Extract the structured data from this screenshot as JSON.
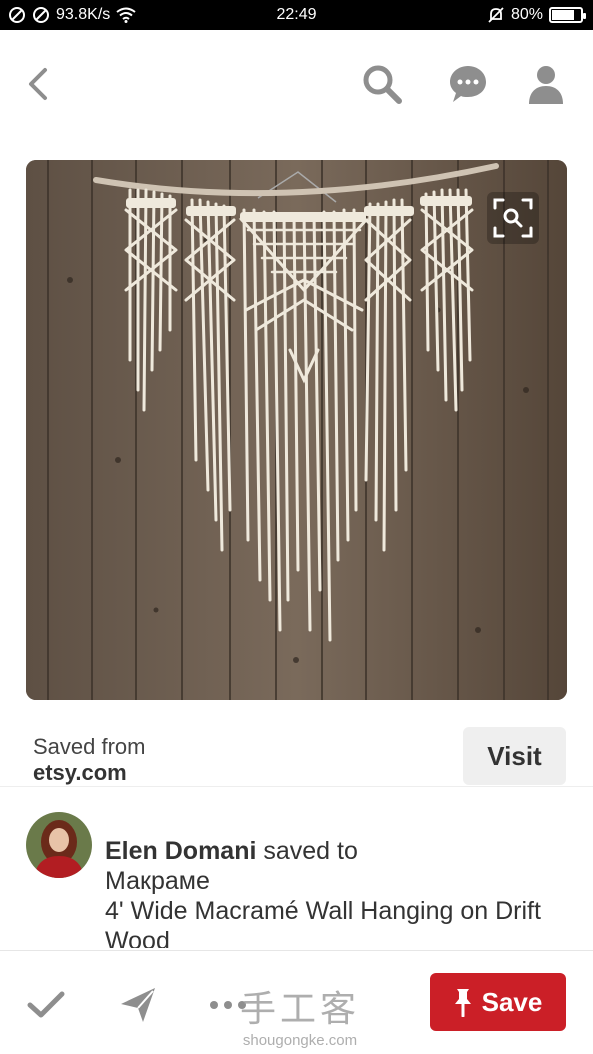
{
  "status_bar": {
    "speed": "93.8K/s",
    "time": "22:49",
    "battery": "80%",
    "battery_level": 0.8
  },
  "nav": {
    "back_icon": "chevron-left-icon",
    "search_icon": "search-icon",
    "messages_icon": "chat-bubble-icon",
    "profile_icon": "person-icon"
  },
  "pin": {
    "image_description_icon": "macrame-wall-hanging-photo",
    "visual_search_icon": "lens-search-icon"
  },
  "source": {
    "saved_from_label": "Saved from",
    "domain": "etsy.com",
    "visit_label": "Visit"
  },
  "saver": {
    "name": "Elen Domani",
    "action": " saved to",
    "board": "Макраме",
    "description": "4' Wide Macramé Wall Hanging on Drift Wood"
  },
  "bottom": {
    "save_label": "Save",
    "check_icon": "check-icon",
    "send_icon": "send-icon",
    "more_icon": "more-icon"
  },
  "watermark": {
    "cn": "手工客",
    "url": "shougongke.com"
  },
  "colors": {
    "save_red": "#cb1f27",
    "icon_gray": "#8e8e8e"
  }
}
